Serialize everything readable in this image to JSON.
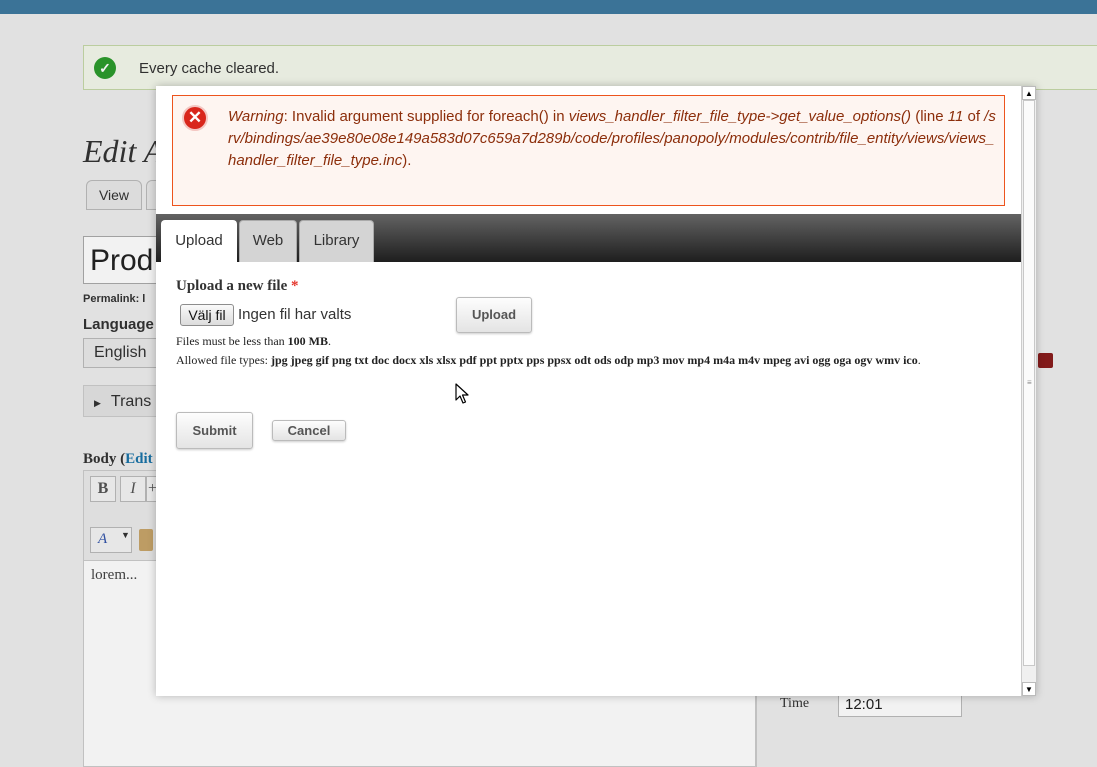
{
  "background": {
    "status_message": "Every cache cleared.",
    "page_title": "Edit A",
    "tabs": {
      "view": "View"
    },
    "title_value": "Prod",
    "permalink_label": "Permalink: l",
    "language_label": "Language",
    "language_value": "English",
    "translations_label": "Trans",
    "body_label": "Body (",
    "body_edit_link": "Edit",
    "editor_buttons": {
      "bold": "B",
      "italic": "I",
      "more": "+"
    },
    "editor_color_glyph": "A",
    "editor_content": "lorem...",
    "time_label": "Time",
    "time_value": "12:01"
  },
  "modal": {
    "error": {
      "label": "Warning",
      "text_1": ": Invalid argument supplied for foreach() in ",
      "function": "views_handler_filter_file_type->get_value_options()",
      "text_2": " (line ",
      "line": "11",
      "text_3": " of ",
      "path": "/srv/bindings/ae39e80e08e149a583d07c659a7d289b/code/profiles/panopoly/modules/contrib/file_entity/views/views_handler_filter_file_type.inc",
      "text_4": ")."
    },
    "tabs": [
      "Upload",
      "Web",
      "Library"
    ],
    "upload_label": "Upload a new file",
    "required_marker": "*",
    "choose_button": "Välj fil",
    "no_file_text": "Ingen fil har valts",
    "upload_button": "Upload",
    "size_text": "Files must be less than ",
    "size_value": "100 MB",
    "size_end": ".",
    "types_text": "Allowed file types: ",
    "types_value": "jpg jpeg gif png txt doc docx xls xlsx pdf ppt pptx pps ppsx odt ods odp mp3 mov mp4 m4a m4v mpeg avi ogg oga ogv wmv ico",
    "types_end": ".",
    "submit_button": "Submit",
    "cancel_button": "Cancel"
  },
  "icons": {
    "status": "check-circle-icon",
    "error": "error-x-icon",
    "cursor": "mouse-pointer-icon"
  },
  "colors": {
    "error_border": "#ed541d",
    "error_text": "#8c2e0b",
    "status_green": "#2d9b2d",
    "tabbar_dark": "#1e1e1e"
  }
}
